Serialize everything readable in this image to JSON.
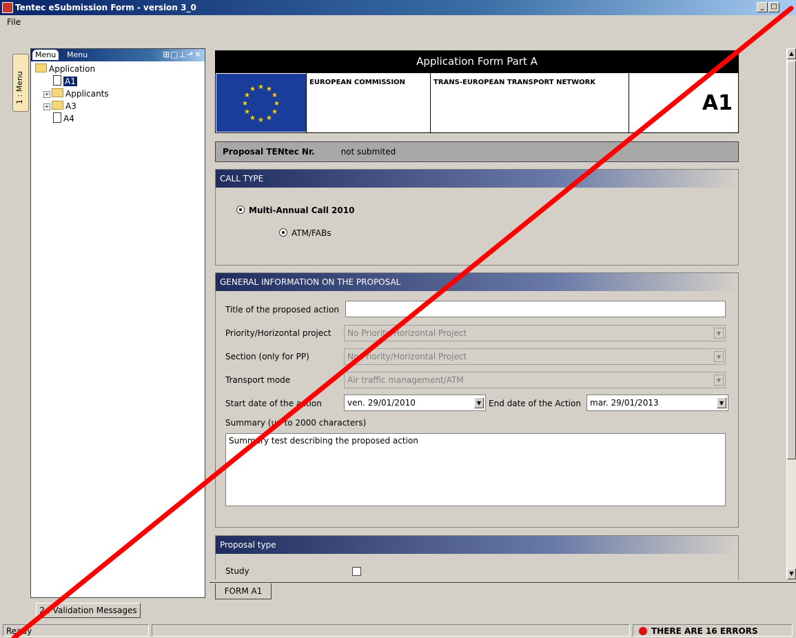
{
  "window": {
    "title": "Tentec eSubmission Form - version 3_0",
    "min": "_",
    "max": "□"
  },
  "menubar": {
    "file": "File"
  },
  "sidetab": {
    "label": "1 : Menu"
  },
  "menu_panel": {
    "tab_label": "Menu",
    "header_label": "Menu",
    "controls": "⊞□⊥⬏✕",
    "tree": {
      "root": "Application",
      "items": [
        "A1",
        "Applicants",
        "A3",
        "A4"
      ]
    }
  },
  "validation_button": {
    "label": "2 : Validation Messages"
  },
  "status": {
    "ready": "Ready",
    "errors": "THERE ARE 16 ERRORS",
    "error_color": "#e01010"
  },
  "form": {
    "title": "Application Form Part A",
    "ec": "EUROPEAN COMMISSION",
    "tent": "TRANS-EUROPEAN TRANSPORT NETWORK",
    "form_code": "A1",
    "proposal_label": "Proposal TENtec Nr.",
    "proposal_value": "not submited",
    "call_type": {
      "header": "CALL TYPE",
      "call": "Multi-Annual Call 2010",
      "subcall": "ATM/FABs"
    },
    "general": {
      "header": "GENERAL INFORMATION ON THE PROPOSAL",
      "title_label": "Title of the proposed action",
      "title_value": "",
      "priority_label": "Priority/Horizontal project",
      "priority_value": "No Priority/Horizontal Project",
      "section_label": "Section (only for PP)",
      "section_value": "No Priority/Horizontal Project",
      "transport_label": "Transport mode",
      "transport_value": "Air traffic management/ATM",
      "start_label": "Start date of the action",
      "start_value": "ven. 29/01/2010",
      "end_label": "End date of the Action",
      "end_value": "mar. 29/01/2013",
      "summary_label": "Summary (up to 2000 characters)",
      "summary_value": "Summary test describing the proposed action"
    },
    "proposal_type": {
      "header": "Proposal type",
      "study_label": "Study"
    },
    "tab_label": "FORM A1"
  },
  "colors": {
    "accent": "#0a246a",
    "annotation": "#ff0000"
  },
  "icons": {
    "folder": "folder-icon",
    "document": "document-icon",
    "eu_flag": "eu-flag-icon"
  }
}
